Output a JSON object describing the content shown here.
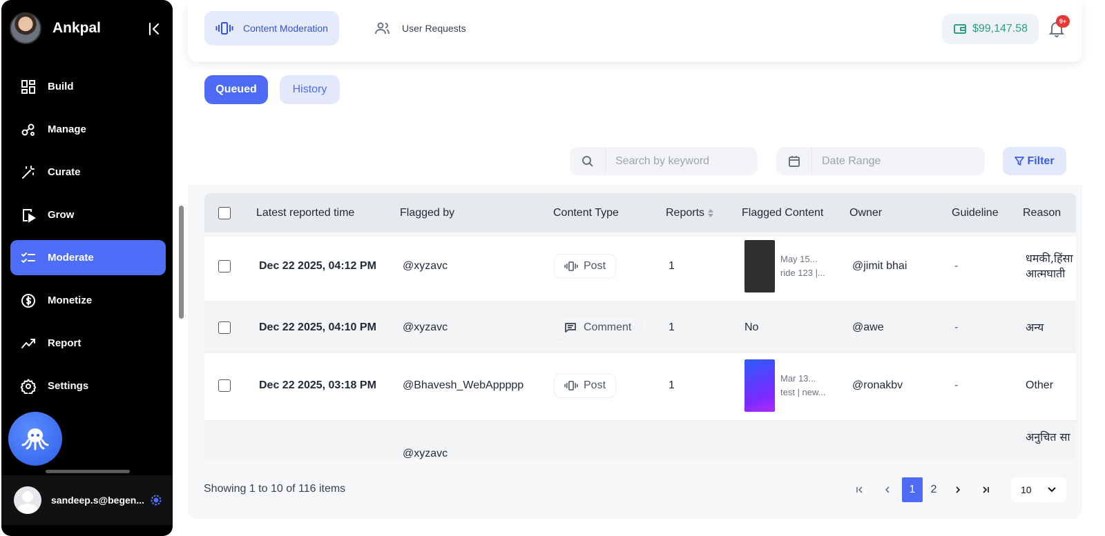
{
  "app": {
    "brand": "Ankpal"
  },
  "sidebar": {
    "items": [
      {
        "label": "Build",
        "icon": "grid-icon"
      },
      {
        "label": "Manage",
        "icon": "nodes-icon"
      },
      {
        "label": "Curate",
        "icon": "wand-icon"
      },
      {
        "label": "Grow",
        "icon": "play-device-icon"
      },
      {
        "label": "Moderate",
        "icon": "checklist-icon",
        "active": true
      },
      {
        "label": "Monetize",
        "icon": "dollar-icon"
      },
      {
        "label": "Report",
        "icon": "chart-line-icon"
      },
      {
        "label": "Settings",
        "icon": "gear-icon"
      }
    ],
    "user_email": "sandeep.s@begen..."
  },
  "header": {
    "tabs": [
      {
        "label": "Content Moderation",
        "active": true
      },
      {
        "label": "User Requests",
        "active": false
      }
    ],
    "balance": "$99,147.58",
    "notification_badge": "9+"
  },
  "subtabs": {
    "queued": "Queued",
    "history": "History"
  },
  "toolbar": {
    "search_placeholder": "Search by keyword",
    "date_placeholder": "Date Range",
    "filter_label": "Filter"
  },
  "table": {
    "headers": {
      "time": "Latest reported time",
      "flagged_by": "Flagged by",
      "content_type": "Content Type",
      "reports": "Reports",
      "flagged_content": "Flagged Content",
      "owner": "Owner",
      "guideline": "Guideline",
      "reason": "Reason"
    },
    "rows": [
      {
        "time": "Dec 22 2025, 04:12 PM",
        "flagged_by": "@xyzavc",
        "type": "Post",
        "reports": "1",
        "content_line1": "May 15...",
        "content_line2": "ride 123 |...",
        "owner": "@jimit bhai",
        "guideline": "-",
        "reason_line1": "धमकी,हिंसा",
        "reason_line2": "आत्मघाती"
      },
      {
        "time": "Dec 22 2025, 04:10 PM",
        "flagged_by": "@xyzavc",
        "type": "Comment",
        "reports": "1",
        "content_text": "No",
        "owner": "@awe",
        "guideline": "-",
        "reason_line1": "अन्य"
      },
      {
        "time": "Dec 22 2025, 03:18 PM",
        "flagged_by": "@Bhavesh_WebAppppp",
        "type": "Post",
        "reports": "1",
        "content_line1": "Mar 13...",
        "content_line2": "test | new...",
        "owner": "@ronakbv",
        "guideline": "-",
        "reason_line1": "Other"
      },
      {
        "flagged_by": "@xyzavc",
        "reason_line1": "अनुचित सा"
      }
    ]
  },
  "pagination": {
    "summary": "Showing 1 to 10 of 116 items",
    "pages": [
      "1",
      "2"
    ],
    "current": "1",
    "page_size": "10"
  }
}
